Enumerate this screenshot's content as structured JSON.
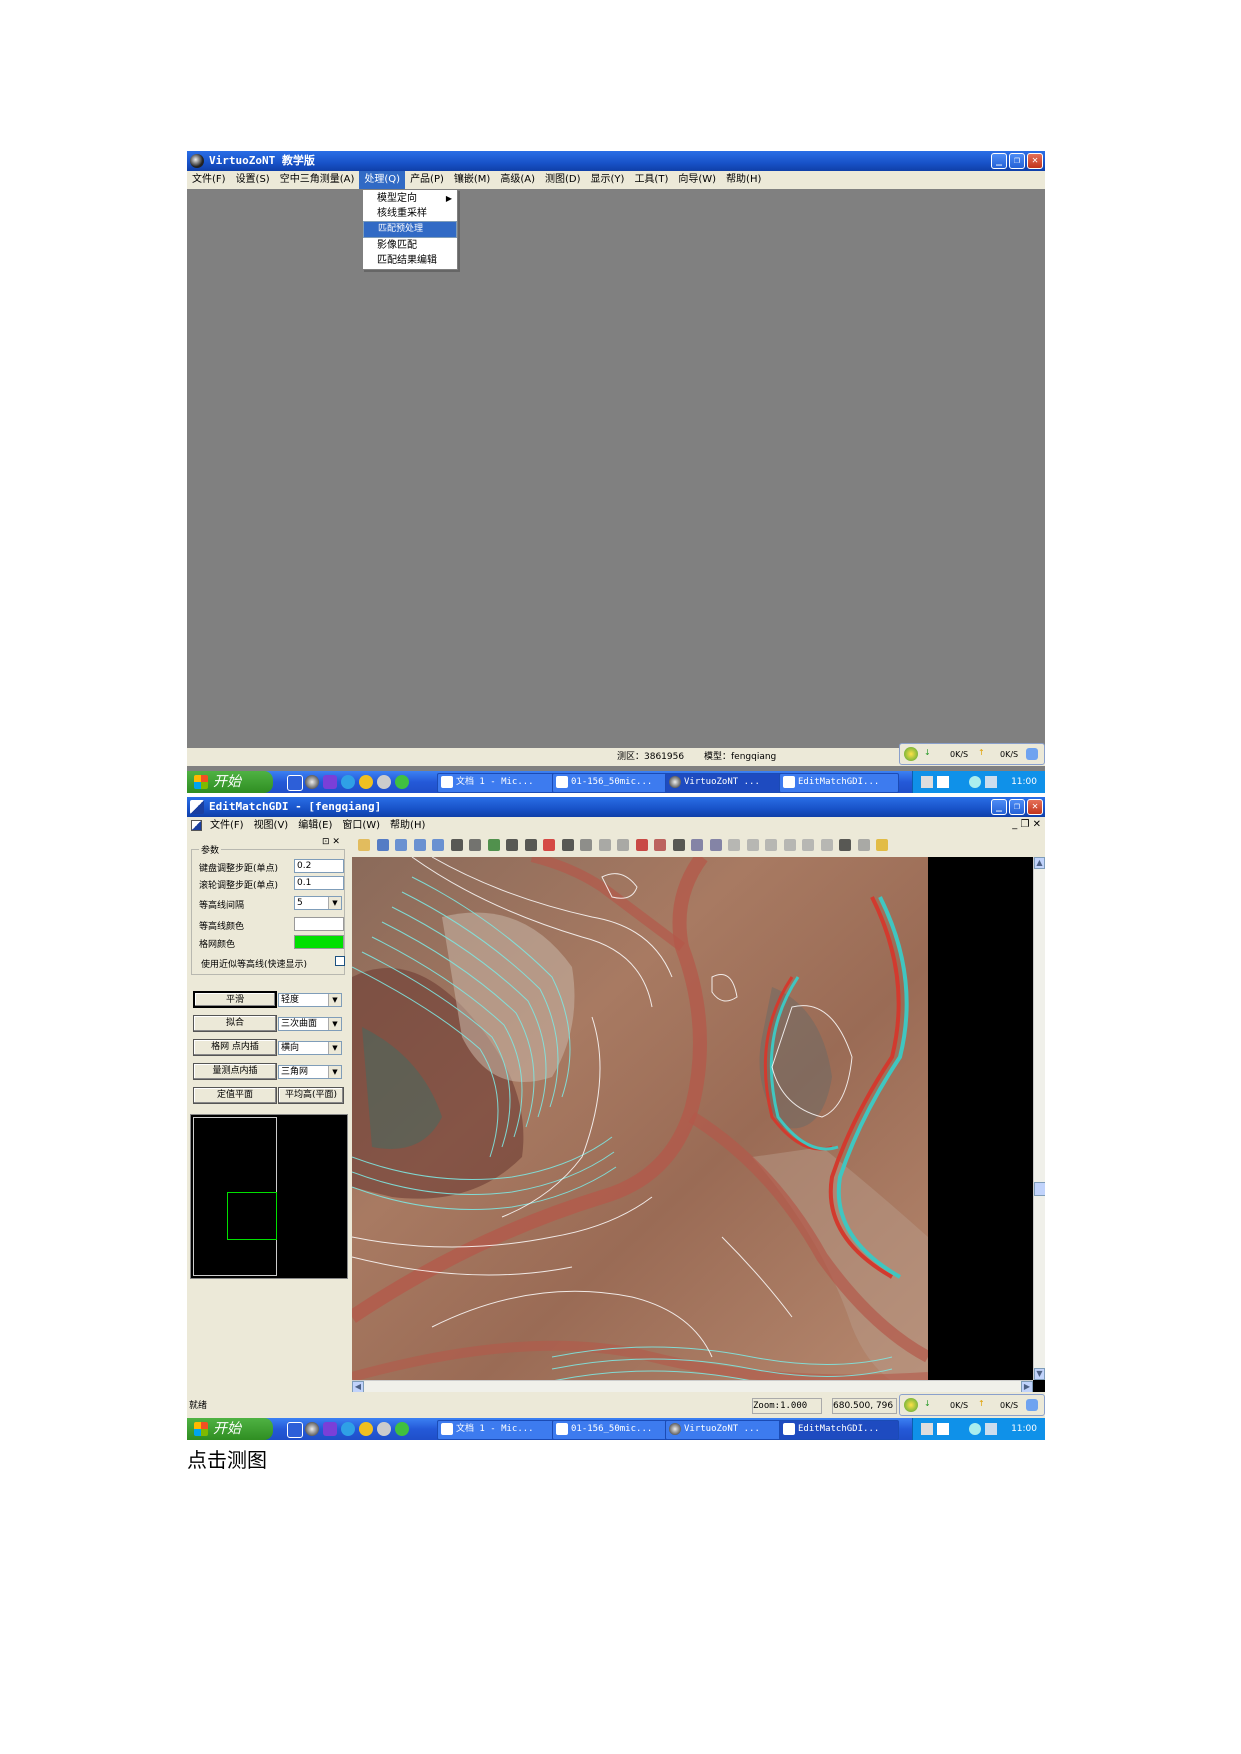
{
  "top_window": {
    "title": "VirtuoZoNT 教学版",
    "menu": [
      "文件(F)",
      "设置(S)",
      "空中三角测量(A)",
      "处理(Q)",
      "产品(P)",
      "镶嵌(M)",
      "高级(A)",
      "测图(D)",
      "显示(Y)",
      "工具(T)",
      "向导(W)",
      "帮助(H)"
    ],
    "active_menu_index": 3,
    "dropdown": [
      "模型定向",
      "核线重采样",
      "匹配预处理",
      "影像匹配",
      "匹配结果编辑"
    ],
    "dropdown_selected_index": 2,
    "status_area": "测区：3861956",
    "status_model": "模型：fengqiang"
  },
  "net_panel": {
    "down_rate": "0K/S",
    "up_rate": "0K/S"
  },
  "taskbar": {
    "start_label": "开始",
    "tasks": [
      "文档 1 - Mic...",
      "01-156_50mic...",
      "VirtuoZoNT ...",
      "EditMatchGDI..."
    ],
    "clock": "11:00"
  },
  "edit_window": {
    "title": "EditMatchGDI - [fengqiang]",
    "menu": [
      "文件(F)",
      "视图(V)",
      "编辑(E)",
      "窗口(W)",
      "帮助(H)"
    ],
    "panel": {
      "group_label": "参数",
      "keyboard_step_label": "键盘调整步距(单点)",
      "keyboard_step_value": "0.2",
      "wheel_step_label": "滚轮调整步距(单点)",
      "wheel_step_value": "0.1",
      "contour_interval_label": "等高线间隔",
      "contour_interval_value": "5",
      "contour_color_label": "等高线颜色",
      "grid_color_label": "格网颜色",
      "approx_contour_label": "使用近似等高线(快速显示)",
      "smooth_button": "平滑",
      "smooth_option": "轻度",
      "fit_button": "拟合",
      "fit_option": "三次曲面",
      "grid_interp_button": "格网 点内插",
      "grid_interp_option": "横向",
      "measure_interp_button": "量测点内插",
      "measure_interp_option": "三角网",
      "set_plane_button": "定值平面",
      "avg_height_button": "平均高(平面)"
    },
    "status_ready": "就绪",
    "zoom": "Zoom:1.000",
    "coords": "680.500,  796"
  },
  "caption": "点击测图",
  "colors": {
    "accent_blue": "#316ac5",
    "grid_green": "#00e000",
    "workspace_gray": "#808080"
  }
}
